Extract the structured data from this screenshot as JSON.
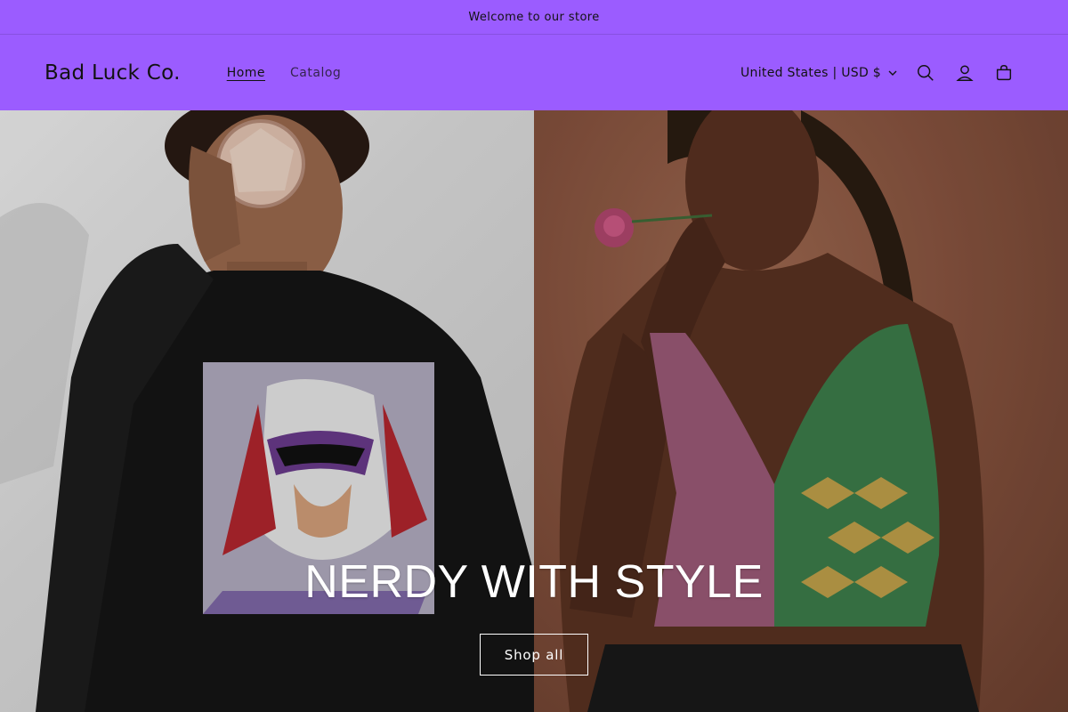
{
  "announcement": {
    "text": "Welcome to our store"
  },
  "header": {
    "logo": "Bad Luck Co.",
    "nav": [
      {
        "label": "Home",
        "active": true
      },
      {
        "label": "Catalog",
        "active": false
      }
    ],
    "country_selector": "United States | USD $",
    "icons": [
      "search-icon",
      "account-icon",
      "cart-icon"
    ]
  },
  "hero": {
    "title": "NERDY WITH STYLE",
    "button_label": "Shop all",
    "left_image": "model-wearing-black-sweatshirt-with-cartoon-print",
    "right_image": "model-wearing-patterned-bralette-holding-rose"
  },
  "colors": {
    "brand_purple": "#9b5cff",
    "text": "#121212"
  }
}
